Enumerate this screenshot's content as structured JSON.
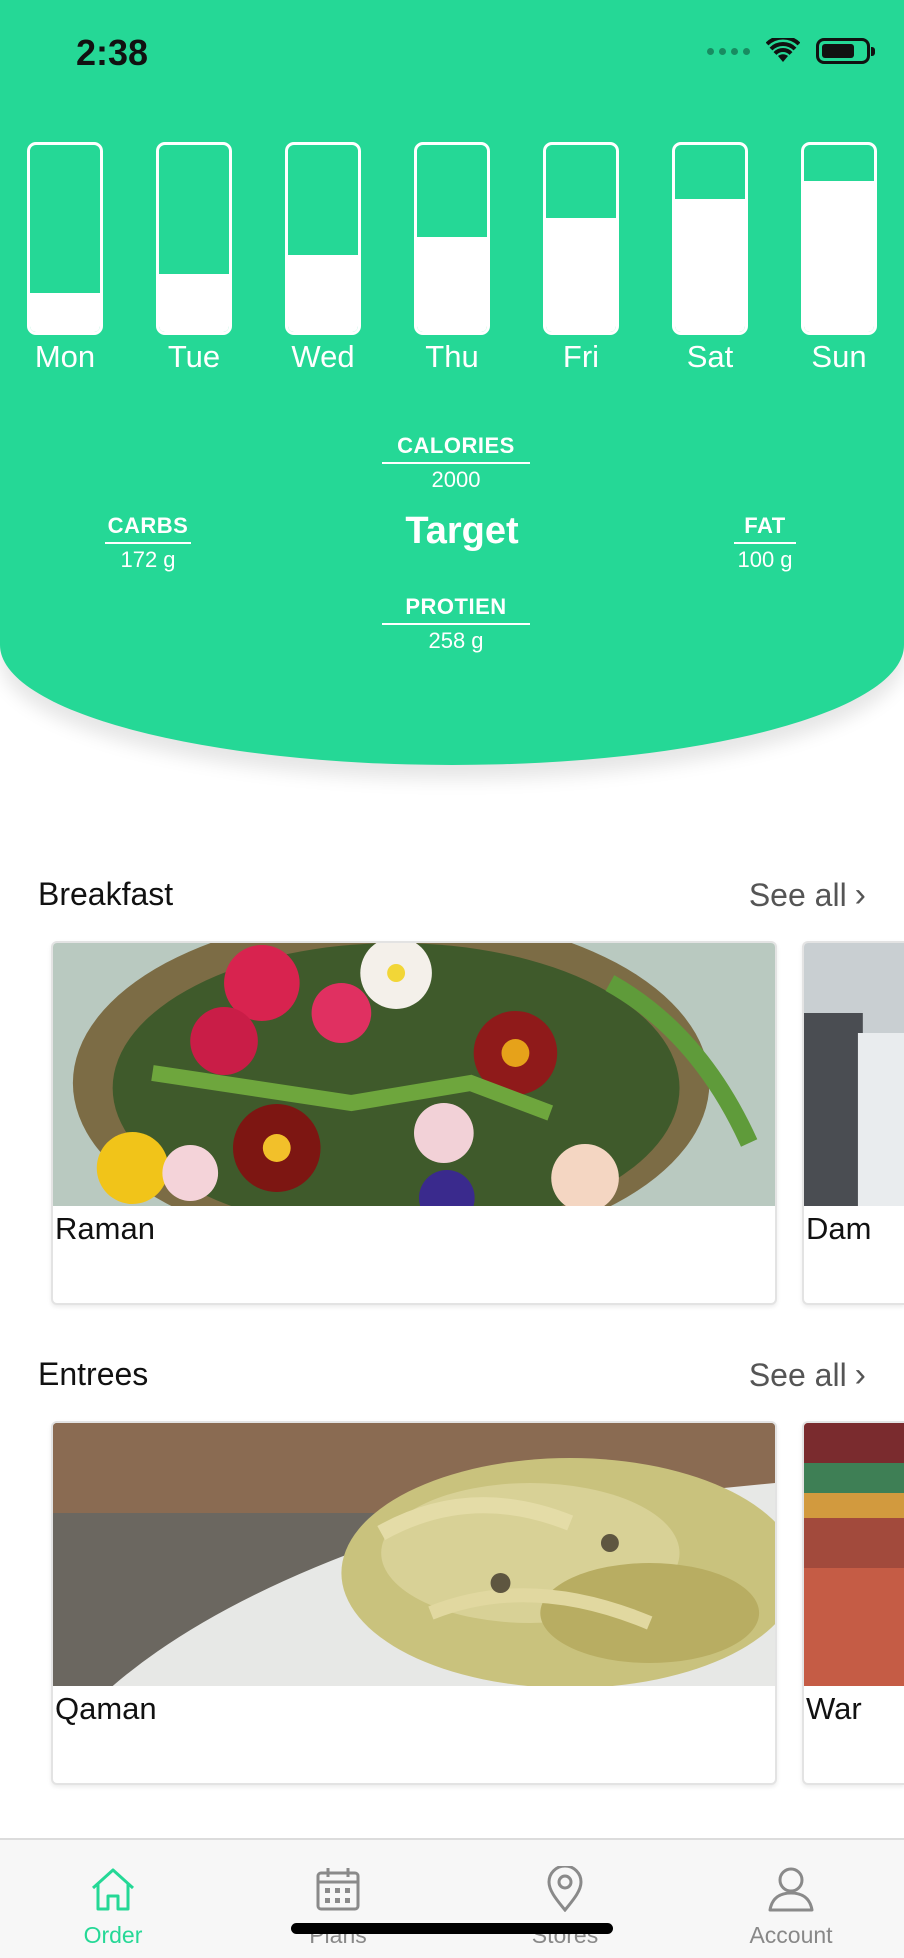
{
  "status_bar": {
    "time": "2:38"
  },
  "week": [
    {
      "day": "Mon",
      "fill": 0.21
    },
    {
      "day": "Tue",
      "fill": 0.31
    },
    {
      "day": "Wed",
      "fill": 0.41
    },
    {
      "day": "Thu",
      "fill": 0.51
    },
    {
      "day": "Fri",
      "fill": 0.61
    },
    {
      "day": "Sat",
      "fill": 0.71
    },
    {
      "day": "Sun",
      "fill": 0.81
    }
  ],
  "macros": {
    "calories": {
      "label": "CALORIES",
      "value": "2000"
    },
    "carbs": {
      "label": "CARBS",
      "value": "172 g"
    },
    "fat": {
      "label": "FAT",
      "value": "100 g"
    },
    "protein": {
      "label": "PROTIEN",
      "value": "258 g"
    },
    "center_label": "Target"
  },
  "sections": {
    "breakfast": {
      "title": "Breakfast",
      "see_all": "See all",
      "cards": [
        {
          "name": "Raman"
        },
        {
          "name": "Dam"
        }
      ]
    },
    "entrees": {
      "title": "Entrees",
      "see_all": "See all",
      "cards": [
        {
          "name": "Qaman"
        },
        {
          "name": "War"
        }
      ]
    }
  },
  "tabbar": {
    "items": [
      {
        "label": "Order",
        "icon": "home-icon",
        "active": true
      },
      {
        "label": "Plans",
        "icon": "calendar-icon",
        "active": false
      },
      {
        "label": "Stores",
        "icon": "location-pin-icon",
        "active": false
      },
      {
        "label": "Account",
        "icon": "person-icon",
        "active": false
      }
    ]
  },
  "colors": {
    "accent": "#25d896",
    "text": "#111111",
    "muted": "#888888"
  }
}
